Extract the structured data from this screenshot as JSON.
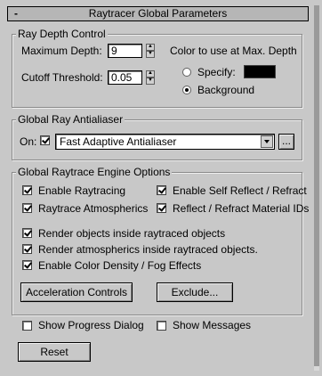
{
  "rollout": {
    "toggle_symbol": "-",
    "title": "Raytracer Global Parameters"
  },
  "ray_depth": {
    "group_title": "Ray Depth Control",
    "max_depth_label": "Maximum Depth:",
    "max_depth_value": "9",
    "cutoff_label": "Cutoff Threshold:",
    "cutoff_value": "0.05",
    "color_label": "Color to use at Max. Depth",
    "specify_label": "Specify:",
    "background_label": "Background",
    "selected": "Background",
    "specify_color": "#000000"
  },
  "antialiaser": {
    "group_title": "Global Ray Antialiaser",
    "on_label": "On:",
    "on_checked": true,
    "selected_value": "Fast Adaptive Antialiaser",
    "options_button": "..."
  },
  "engine": {
    "group_title": "Global Raytrace Engine Options",
    "options": [
      {
        "label": "Enable Raytracing",
        "checked": true
      },
      {
        "label": "Enable Self Reflect / Refract",
        "checked": true
      },
      {
        "label": "Raytrace Atmospherics",
        "checked": true
      },
      {
        "label": "Reflect / Refract Material IDs",
        "checked": true
      },
      {
        "label": "Render objects inside raytraced objects",
        "checked": true
      },
      {
        "label": "Render atmospherics inside raytraced objects.",
        "checked": true
      },
      {
        "label": "Enable Color Density / Fog Effects",
        "checked": true
      }
    ],
    "acceleration_button": "Acceleration Controls",
    "exclude_button": "Exclude..."
  },
  "bottom": {
    "show_progress_label": "Show Progress Dialog",
    "show_progress_checked": false,
    "show_messages_label": "Show Messages",
    "show_messages_checked": false,
    "reset_button": "Reset"
  }
}
